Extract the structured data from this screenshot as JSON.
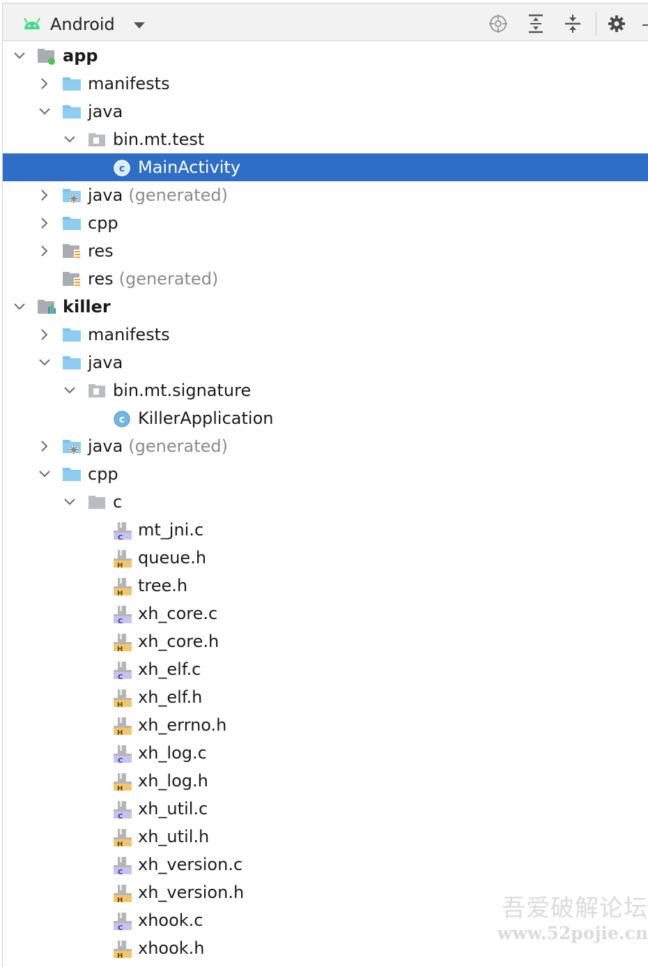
{
  "toolbar": {
    "view_label": "Android",
    "icons": [
      "android-icon",
      "dropdown-arrow-icon",
      "locate-icon",
      "expand-all-icon",
      "collapse-all-icon",
      "gear-icon"
    ],
    "colors": {
      "background": "#f2f2f2",
      "android_green": "#3ddc84"
    }
  },
  "tree": {
    "selection_color": "#2f6ec6",
    "rows": [
      {
        "label": "app",
        "suffix": "",
        "depth": 0,
        "chevron": "down",
        "icon": "module-icon",
        "bold": true
      },
      {
        "label": "manifests",
        "suffix": "",
        "depth": 1,
        "chevron": "right",
        "icon": "folder-icon"
      },
      {
        "label": "java",
        "suffix": "",
        "depth": 1,
        "chevron": "down",
        "icon": "folder-icon"
      },
      {
        "label": "bin.mt.test",
        "suffix": "",
        "depth": 2,
        "chevron": "down",
        "icon": "package-icon"
      },
      {
        "label": "MainActivity",
        "suffix": "",
        "depth": 3,
        "chevron": "none",
        "icon": "class-icon",
        "selected": true
      },
      {
        "label": "java",
        "suffix": "(generated)",
        "depth": 1,
        "chevron": "right",
        "icon": "generated-folder-icon"
      },
      {
        "label": "cpp",
        "suffix": "",
        "depth": 1,
        "chevron": "right",
        "icon": "folder-icon"
      },
      {
        "label": "res",
        "suffix": "",
        "depth": 1,
        "chevron": "right",
        "icon": "resource-folder-icon"
      },
      {
        "label": "res",
        "suffix": "(generated)",
        "depth": 1,
        "chevron": "none",
        "icon": "resource-folder-icon"
      },
      {
        "label": "killer",
        "suffix": "",
        "depth": 0,
        "chevron": "down",
        "icon": "library-module-icon",
        "bold": true
      },
      {
        "label": "manifests",
        "suffix": "",
        "depth": 1,
        "chevron": "right",
        "icon": "folder-icon"
      },
      {
        "label": "java",
        "suffix": "",
        "depth": 1,
        "chevron": "down",
        "icon": "folder-icon"
      },
      {
        "label": "bin.mt.signature",
        "suffix": "",
        "depth": 2,
        "chevron": "down",
        "icon": "package-icon"
      },
      {
        "label": "KillerApplication",
        "suffix": "",
        "depth": 3,
        "chevron": "none",
        "icon": "class-icon"
      },
      {
        "label": "java",
        "suffix": "(generated)",
        "depth": 1,
        "chevron": "right",
        "icon": "generated-folder-icon"
      },
      {
        "label": "cpp",
        "suffix": "",
        "depth": 1,
        "chevron": "down",
        "icon": "folder-icon"
      },
      {
        "label": "c",
        "suffix": "",
        "depth": 2,
        "chevron": "down",
        "icon": "plain-folder-icon"
      },
      {
        "label": "mt_jni.c",
        "suffix": "",
        "depth": 3,
        "chevron": "none",
        "icon": "c-file-icon"
      },
      {
        "label": "queue.h",
        "suffix": "",
        "depth": 3,
        "chevron": "none",
        "icon": "h-file-icon"
      },
      {
        "label": "tree.h",
        "suffix": "",
        "depth": 3,
        "chevron": "none",
        "icon": "h-file-icon"
      },
      {
        "label": "xh_core.c",
        "suffix": "",
        "depth": 3,
        "chevron": "none",
        "icon": "c-file-icon"
      },
      {
        "label": "xh_core.h",
        "suffix": "",
        "depth": 3,
        "chevron": "none",
        "icon": "h-file-icon"
      },
      {
        "label": "xh_elf.c",
        "suffix": "",
        "depth": 3,
        "chevron": "none",
        "icon": "c-file-icon"
      },
      {
        "label": "xh_elf.h",
        "suffix": "",
        "depth": 3,
        "chevron": "none",
        "icon": "h-file-icon"
      },
      {
        "label": "xh_errno.h",
        "suffix": "",
        "depth": 3,
        "chevron": "none",
        "icon": "h-file-icon"
      },
      {
        "label": "xh_log.c",
        "suffix": "",
        "depth": 3,
        "chevron": "none",
        "icon": "c-file-icon"
      },
      {
        "label": "xh_log.h",
        "suffix": "",
        "depth": 3,
        "chevron": "none",
        "icon": "h-file-icon"
      },
      {
        "label": "xh_util.c",
        "suffix": "",
        "depth": 3,
        "chevron": "none",
        "icon": "c-file-icon"
      },
      {
        "label": "xh_util.h",
        "suffix": "",
        "depth": 3,
        "chevron": "none",
        "icon": "h-file-icon"
      },
      {
        "label": "xh_version.c",
        "suffix": "",
        "depth": 3,
        "chevron": "none",
        "icon": "c-file-icon"
      },
      {
        "label": "xh_version.h",
        "suffix": "",
        "depth": 3,
        "chevron": "none",
        "icon": "h-file-icon"
      },
      {
        "label": "xhook.c",
        "suffix": "",
        "depth": 3,
        "chevron": "none",
        "icon": "c-file-icon"
      },
      {
        "label": "xhook.h",
        "suffix": "",
        "depth": 3,
        "chevron": "none",
        "icon": "h-file-icon"
      }
    ]
  },
  "watermark": {
    "line1": "吾爱破解论坛",
    "line2": "www.52pojie.cn"
  }
}
